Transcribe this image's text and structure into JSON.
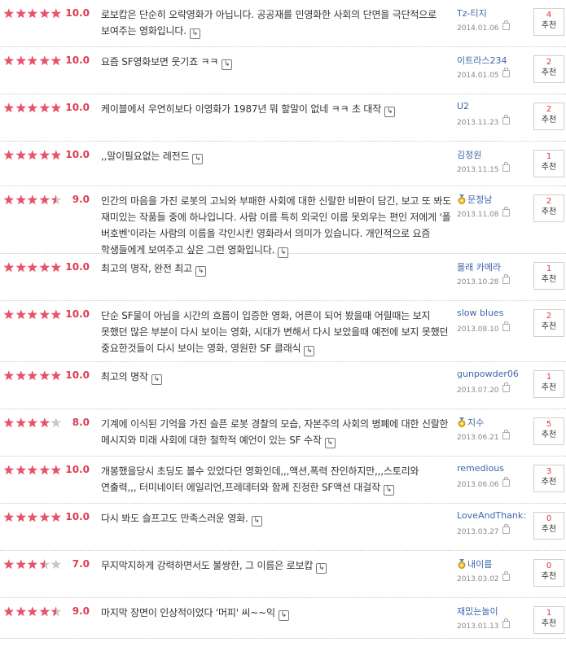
{
  "colors": {
    "star_on": "#e8536b",
    "star_off": "#c8c8c8",
    "score": "#e03b52",
    "author": "#3d66a9"
  },
  "reviews": [
    {
      "rating": 10,
      "score": "10.0",
      "comment": "로보캅은 단순히 오락영화가 아닙니다. 공공재를 민영화한 사회의 단면을 극단적으로 보여주는 영화입니다.",
      "author": "Tz-티지",
      "badge": false,
      "date": "2014.01.06",
      "count": "4",
      "rec_label": "추천"
    },
    {
      "rating": 10,
      "score": "10.0",
      "comment": "요즘 SF영화보면 웃기죠 ㅋㅋ",
      "author": "이트라스234",
      "badge": false,
      "date": "2014.01.05",
      "count": "2",
      "rec_label": "추천"
    },
    {
      "rating": 10,
      "score": "10.0",
      "comment": "케이블에서 우연히보다 이영화가 1987년 뭐 할말이 없네 ㅋㅋ 초 대작",
      "author": "U2",
      "badge": false,
      "date": "2013.11.23",
      "count": "2",
      "rec_label": "추천"
    },
    {
      "rating": 10,
      "score": "10.0",
      "comment": ",,말이필요없는 레전드",
      "author": "김정원",
      "badge": false,
      "date": "2013.11.15",
      "count": "1",
      "rec_label": "추천"
    },
    {
      "rating": 9,
      "score": "9.0",
      "comment": "인간의 마음을 가진 로봇의 고뇌와 부패한 사회에 대한 신랄한 비판이 담긴, 보고 또 봐도 재미있는 작품들 중에 하나입니다. 사람 이름 특히 외국인 이름 못외우는 편인 저에게 '폴 버호벤'이라는 사람의 이름을 각인시킨 영화라서 의미가 있습니다. 개인적으로 요즘 학생들에게 보여주고 싶은 그런 영화입니다.",
      "author": "문정남",
      "badge": true,
      "date": "2013.11.08",
      "count": "2",
      "rec_label": "추천"
    },
    {
      "rating": 10,
      "score": "10.0",
      "comment": "최고의 명작, 완전 최고",
      "author": "몰래 카메라",
      "badge": false,
      "date": "2013.10.28",
      "count": "1",
      "rec_label": "추천"
    },
    {
      "rating": 10,
      "score": "10.0",
      "comment": "단순 SF물이 아님을 시간의 흐름이 입증한 영화, 어른이 되어 봤을때 어릴때는 보지 못했던 많은 부분이 다시 보이는 영화, 시대가 변해서 다시 보았을때 예전에 보지 못했던 중요한것들이 다시 보이는 영화, 영원한 SF 클래식",
      "author": "slow blues",
      "badge": false,
      "date": "2013.08.10",
      "count": "2",
      "rec_label": "추천"
    },
    {
      "rating": 10,
      "score": "10.0",
      "comment": "최고의 명작",
      "author": "gunpowder06",
      "badge": false,
      "date": "2013.07.20",
      "count": "1",
      "rec_label": "추천"
    },
    {
      "rating": 8,
      "score": "8.0",
      "comment": "기계에 이식된 기억을 가진 슬픈 로봇 경찰의 모습, 자본주의 사회의 병폐에 대한 신랄한 메시지와 미래 사회에 대한 철학적 예언이 있는 SF 수작",
      "author": "지수",
      "badge": true,
      "date": "2013.06.21",
      "count": "5",
      "rec_label": "추천"
    },
    {
      "rating": 10,
      "score": "10.0",
      "comment": "개봉했을당시 초딩도 볼수 있었다던 영화인데,,,액션,폭력 잔인하지만,,,스토리와 연출력,,, 터미네이터 에일리언,프레데터와 함께 진정한 SF액션 대걸작",
      "author": "remedious",
      "badge": false,
      "date": "2013.06.06",
      "count": "3",
      "rec_label": "추천"
    },
    {
      "rating": 10,
      "score": "10.0",
      "comment": "다시 봐도 슬프고도 만족스러운 영화.",
      "author": "LoveAndThank:",
      "badge": false,
      "date": "2013.03.27",
      "count": "0",
      "rec_label": "추천"
    },
    {
      "rating": 7,
      "score": "7.0",
      "comment": "무지막지하게 강력하면서도 불쌍한, 그 이름은 로보캅",
      "author": "내이름",
      "badge": true,
      "date": "2013.03.02",
      "count": "0",
      "rec_label": "추천"
    },
    {
      "rating": 9,
      "score": "9.0",
      "comment": "마지막 장면이 인상적이었다 '머피' 씨~~익",
      "author": "재밌는놀이",
      "badge": false,
      "date": "2013.01.13",
      "count": "1",
      "rec_label": "추천"
    }
  ]
}
